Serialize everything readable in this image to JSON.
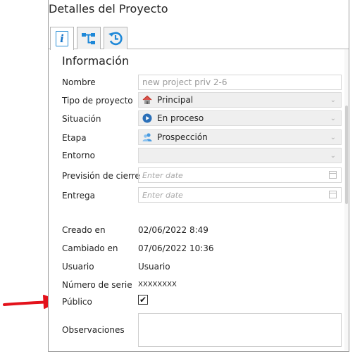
{
  "window": {
    "title": "Detalles del Proyecto"
  },
  "tabs": [
    {
      "icon": "info-icon",
      "active": true
    },
    {
      "icon": "hierarchy-icon",
      "active": false
    },
    {
      "icon": "history-icon",
      "active": false
    }
  ],
  "section": {
    "title": "Información"
  },
  "form": {
    "nombre": {
      "label": "Nombre",
      "value": "new project priv 2-6"
    },
    "tipo": {
      "label": "Tipo de proyecto",
      "value": "Principal",
      "icon": "house-icon"
    },
    "situacion": {
      "label": "Situación",
      "value": "En proceso",
      "icon": "play-icon"
    },
    "etapa": {
      "label": "Etapa",
      "value": "Prospección",
      "icon": "people-icon"
    },
    "entorno": {
      "label": "Entorno",
      "value": ""
    },
    "prevision": {
      "label": "Previsión de cierre",
      "placeholder": "Enter date"
    },
    "entrega": {
      "label": "Entrega",
      "placeholder": "Enter date"
    }
  },
  "meta": {
    "creado": {
      "label": "Creado en",
      "value": "02/06/2022 8:49"
    },
    "cambiado": {
      "label": "Cambiado en",
      "value": "07/06/2022 10:36"
    },
    "usuario": {
      "label": "Usuario",
      "value": "Usuario"
    },
    "serie": {
      "label": "Número de serie",
      "value": "XXXXXXXX"
    },
    "publico": {
      "label": "Público",
      "checked": true,
      "check_glyph": "✔"
    },
    "observaciones": {
      "label": "Observaciones",
      "value": ""
    }
  },
  "colors": {
    "accent": "#1976c9",
    "annotation_arrow": "#e3121b"
  }
}
